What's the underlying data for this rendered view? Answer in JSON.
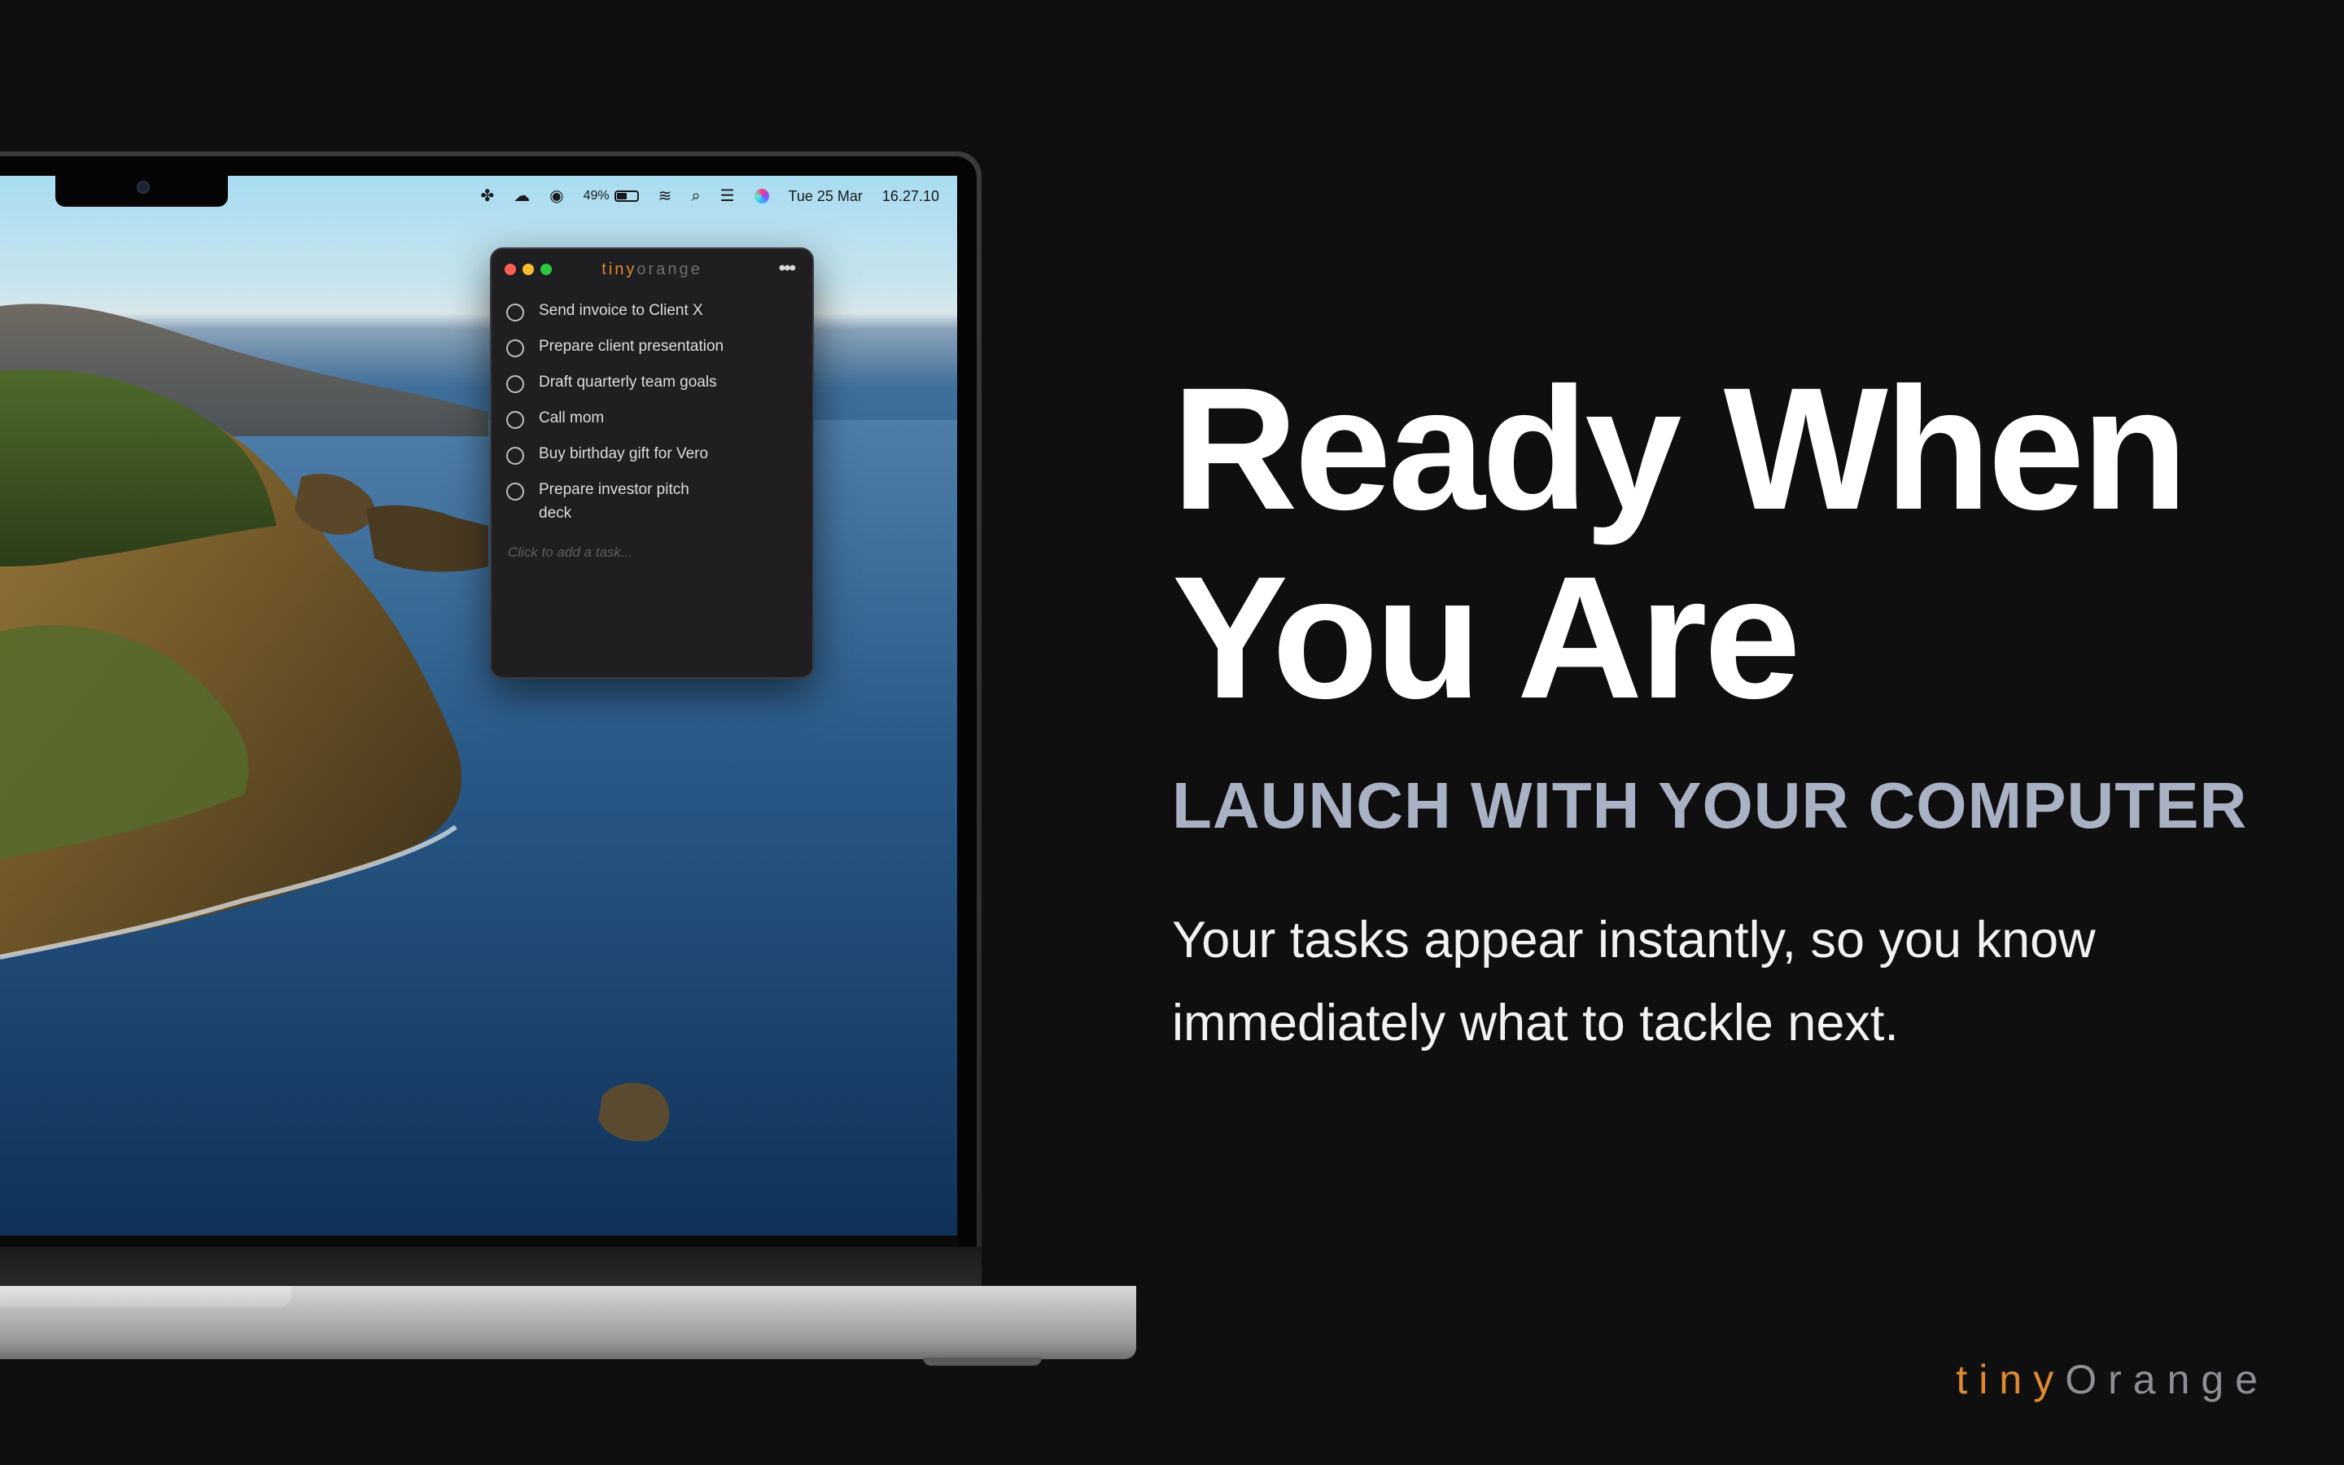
{
  "menubar": {
    "battery_percent": "49%",
    "battery_level": 0.49,
    "date": "Tue 25 Mar",
    "time": "16.27.10",
    "icons": [
      "figma-icon",
      "weather-icon",
      "play-icon",
      "battery-icon",
      "wifi-icon",
      "search-icon",
      "control-center-icon",
      "siri-icon"
    ]
  },
  "app": {
    "title_part1": "tiny",
    "title_part2": "orange",
    "tasks": [
      "Send invoice to Client X",
      "Prepare client presentation",
      "Draft quarterly team goals",
      "Call mom",
      "Buy birthday gift for Vero",
      "Prepare investor pitch deck"
    ],
    "add_placeholder": "Click to add a task..."
  },
  "hero": {
    "headline_line1": "Ready When",
    "headline_line2": "You Are",
    "subheadline": "LAUNCH WITH YOUR COMPUTER",
    "body": "Your tasks appear instantly, so you know immediately what to tackle next."
  },
  "brand": {
    "part1": "tiny",
    "part2": "Orange"
  },
  "colors": {
    "background": "#0f0f10",
    "brand_orange": "#e08a31",
    "brand_gray": "#8d8f95",
    "subhead": "#a9b2c4"
  }
}
